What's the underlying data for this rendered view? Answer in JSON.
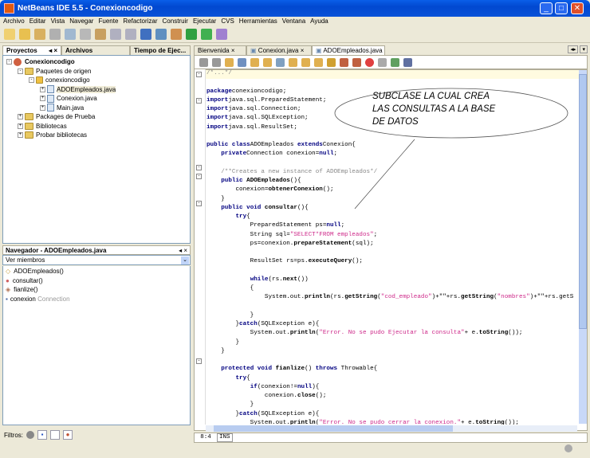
{
  "window": {
    "title": "NetBeans IDE 5.5 - Conexioncodigo",
    "min": "_",
    "max": "□",
    "close": "✕"
  },
  "menu": [
    "Archivo",
    "Editar",
    "Vista",
    "Navegar",
    "Fuente",
    "Refactorizar",
    "Construir",
    "Ejecutar",
    "CVS",
    "Herramientas",
    "Ventana",
    "Ayuda"
  ],
  "left_tabs": [
    "Proyectos",
    "Archivos",
    "Tiempo de Ejec..."
  ],
  "tree": {
    "project": "Conexioncodigo",
    "src": "Paquetes de origen",
    "pkg": "conexioncodigo",
    "files": [
      "ADOEmpleados.java",
      "Conexion.java",
      "Main.java"
    ],
    "others": [
      "Packages de Prueba",
      "Bibliotecas",
      "Probar bibliotecas"
    ]
  },
  "navigator": {
    "title": "Navegador - ADOEmpleados.java",
    "combo": "Ver miembros",
    "members": [
      "ADOEmpleados()",
      "consultar()",
      "fianlize()",
      "conexion"
    ],
    "member_type": "Connection",
    "filters_label": "Filtros:"
  },
  "editor_tabs": [
    "Bienvenida",
    "Conexion.java",
    "ADOEmpleados.java"
  ],
  "status": {
    "pos": "8:4",
    "mode": "INS"
  },
  "callout": {
    "lines": [
      "SUBCLASE LA CUAL CREA",
      "LAS CONSULTAS A LA BASE",
      "DE DATOS"
    ]
  },
  "code": [
    [
      [
        "cm",
        "/*...*/"
      ]
    ],
    [],
    [
      [
        "kw",
        "package"
      ],
      [
        "",
        "conexioncodigo;"
      ]
    ],
    [
      [
        "kw",
        "import"
      ],
      [
        "",
        "java.sql.PreparedStatement;"
      ]
    ],
    [
      [
        "kw",
        "import"
      ],
      [
        "",
        "java.sql.Connection;"
      ]
    ],
    [
      [
        "kw",
        "import"
      ],
      [
        "",
        "java.sql.SQLException;"
      ]
    ],
    [
      [
        "kw",
        "import"
      ],
      [
        "",
        "java.sql.ResultSet;"
      ]
    ],
    [],
    [
      [
        "kw",
        "public class"
      ],
      [
        "",
        "ADOEmpleados "
      ],
      [
        "kw",
        "extends"
      ],
      [
        "",
        "Conexion{"
      ]
    ],
    [
      [
        "",
        "    "
      ],
      [
        "kw",
        "private"
      ],
      [
        "",
        "Connection conexion="
      ],
      [
        "kw",
        "null"
      ],
      [
        "",
        ";"
      ]
    ],
    [],
    [
      [
        "cm",
        "    /**Creates a new instance of ADOEmpleados*/"
      ]
    ],
    [
      [
        "",
        "    "
      ],
      [
        "kw",
        "public"
      ],
      [
        "m",
        " ADOEmpleados"
      ],
      [
        "",
        "(){"
      ]
    ],
    [
      [
        "",
        "        conexion="
      ],
      [
        "m",
        "obtenerConexion"
      ],
      [
        "",
        "();"
      ]
    ],
    [
      [
        "",
        "    }"
      ]
    ],
    [
      [
        "",
        "    "
      ],
      [
        "kw",
        "public void"
      ],
      [
        "m",
        " consultar"
      ],
      [
        "",
        "(){"
      ]
    ],
    [
      [
        "",
        "        "
      ],
      [
        "kw",
        "try"
      ],
      [
        "",
        "{"
      ]
    ],
    [
      [
        "",
        "            PreparedStatement ps="
      ],
      [
        "kw",
        "null"
      ],
      [
        "",
        ";"
      ]
    ],
    [
      [
        "",
        "            String sql="
      ],
      [
        "str",
        "\"SELECT*FROM empleados\""
      ],
      [
        "",
        ";"
      ]
    ],
    [
      [
        "",
        "            ps=conexion."
      ],
      [
        "m",
        "prepareStatement"
      ],
      [
        "",
        "(sql);"
      ]
    ],
    [],
    [
      [
        "",
        "            ResultSet rs=ps."
      ],
      [
        "m",
        "executeQuery"
      ],
      [
        "",
        "();"
      ]
    ],
    [],
    [
      [
        "",
        "            "
      ],
      [
        "kw",
        "while"
      ],
      [
        "",
        "(rs."
      ],
      [
        "m",
        "next"
      ],
      [
        "",
        "())"
      ]
    ],
    [
      [
        "",
        "            {"
      ]
    ],
    [
      [
        "",
        "                System.out."
      ],
      [
        "m",
        "println"
      ],
      [
        "",
        "(rs."
      ],
      [
        "m",
        "getString"
      ],
      [
        "",
        "("
      ],
      [
        "str",
        "\"cod_empleado\""
      ],
      [
        "",
        ")+\"\"+rs."
      ],
      [
        "m",
        "getString"
      ],
      [
        "",
        "("
      ],
      [
        "str",
        "\"nombres\""
      ],
      [
        "",
        ")+\"\"+rs.getS"
      ]
    ],
    [],
    [
      [
        "",
        "            }"
      ]
    ],
    [
      [
        "",
        "        }"
      ],
      [
        "kw",
        "catch"
      ],
      [
        "",
        "(SQLException e){"
      ]
    ],
    [
      [
        "",
        "            System.out."
      ],
      [
        "m",
        "println"
      ],
      [
        "",
        "("
      ],
      [
        "str",
        "\"Error. No se pudo Ejecutar la consulta\""
      ],
      [
        "",
        "+ e."
      ],
      [
        "m",
        "toString"
      ],
      [
        "",
        "());"
      ]
    ],
    [
      [
        "",
        "        }"
      ]
    ],
    [
      [
        "",
        "    }"
      ]
    ],
    [],
    [
      [
        "",
        "    "
      ],
      [
        "kw",
        "protected void"
      ],
      [
        "m",
        " fianlize"
      ],
      [
        "",
        "() "
      ],
      [
        "kw",
        "throws"
      ],
      [
        "",
        " Throwable{"
      ]
    ],
    [
      [
        "",
        "        "
      ],
      [
        "kw",
        "try"
      ],
      [
        "",
        "{"
      ]
    ],
    [
      [
        "",
        "            "
      ],
      [
        "kw",
        "if"
      ],
      [
        "",
        "(conexion!="
      ],
      [
        "kw",
        "null"
      ],
      [
        "",
        "){"
      ]
    ],
    [
      [
        "",
        "                conexion."
      ],
      [
        "m",
        "close"
      ],
      [
        "",
        "();"
      ]
    ],
    [
      [
        "",
        "            }"
      ]
    ],
    [
      [
        "",
        "        }"
      ],
      [
        "kw",
        "catch"
      ],
      [
        "",
        "(SQLException e){"
      ]
    ],
    [
      [
        "",
        "            System.out."
      ],
      [
        "m",
        "println"
      ],
      [
        "",
        "("
      ],
      [
        "str",
        "\"Error. No se pudo cerrar la conexion.\""
      ],
      [
        "",
        "+ e."
      ],
      [
        "m",
        "toString"
      ],
      [
        "",
        "());"
      ]
    ],
    [
      [
        "",
        "        }"
      ]
    ]
  ]
}
